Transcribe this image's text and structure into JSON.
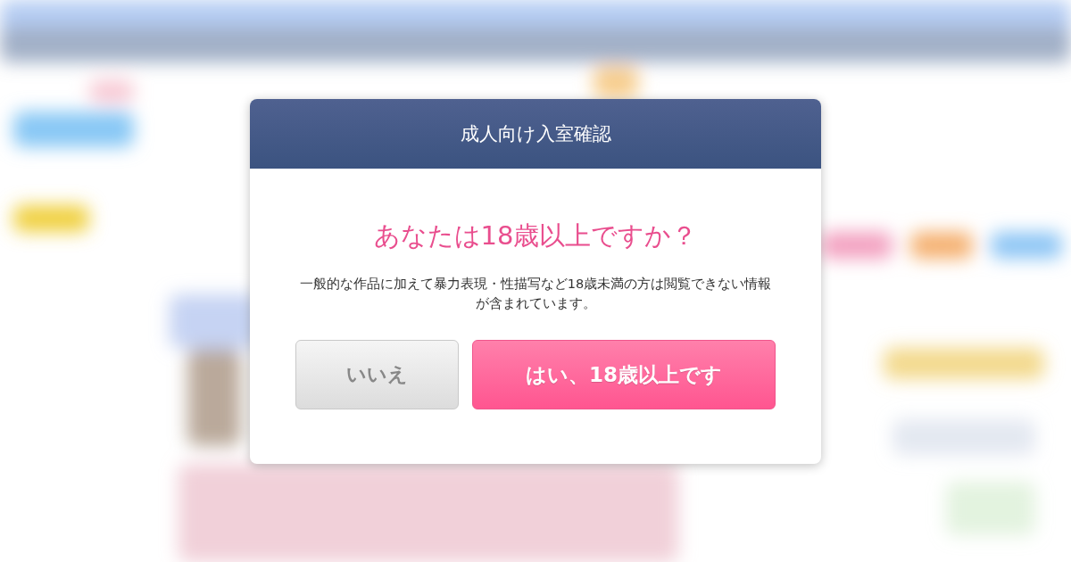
{
  "dialog": {
    "title": "成人向け入室確認",
    "question": "あなたは18歳以上ですか？",
    "message": "一般的な作品に加えて暴力表現・性描写など18歳未満の方は閲覧できない情報が含まれています。",
    "buttons": [
      {
        "label": "いいえ",
        "kind": "decline"
      },
      {
        "label": "はい、18歳以上です",
        "kind": "accept"
      }
    ]
  }
}
